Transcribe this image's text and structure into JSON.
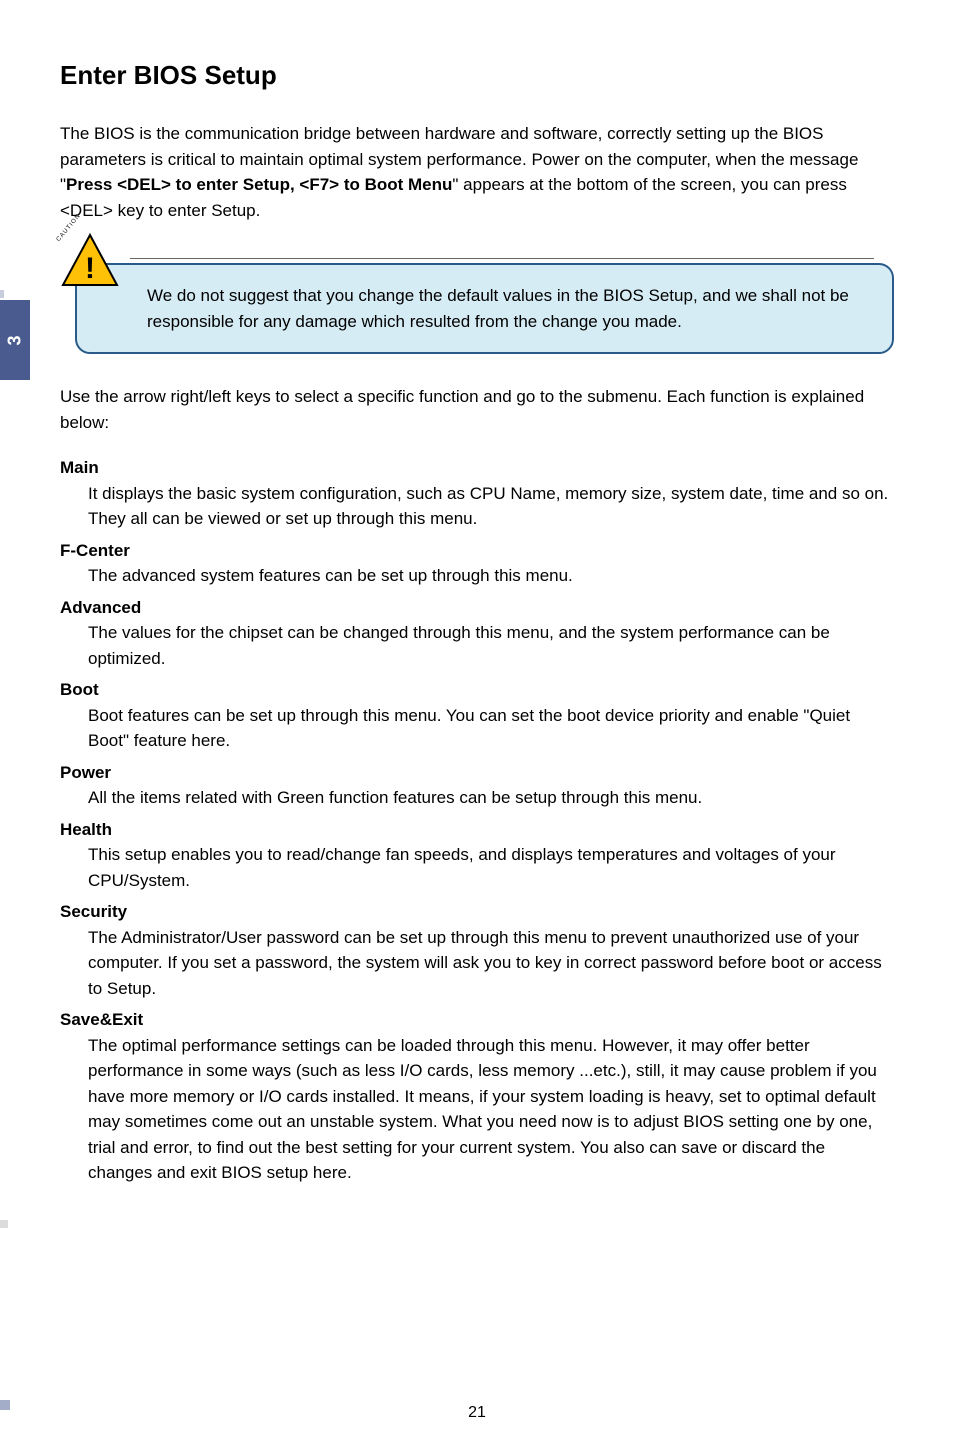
{
  "sideTab": "3",
  "title": "Enter BIOS Setup",
  "intro": {
    "part1": "The BIOS is the communication bridge between hardware and software, correctly setting up the BIOS parameters is critical to maintain optimal system performance. Power on the computer, when the message \"",
    "bold": "Press <DEL> to enter Setup, <F7> to Boot Menu",
    "part2": "\" appears at the bottom of the screen, you can press <DEL> key to enter Setup."
  },
  "caution": {
    "label": "CAUTION",
    "exclaim": "!",
    "text": "We do not suggest that you change the default values in the BIOS Setup, and we shall not be responsible for any damage which resulted from the change you made."
  },
  "postCaution": "Use the arrow right/left keys to select a specific function and go to the submenu. Each function is explained below:",
  "menus": [
    {
      "name": "Main",
      "desc": "It displays the basic system configuration, such as CPU Name, memory size, system date, time and so on. They all can be viewed or set up through this menu."
    },
    {
      "name": "F-Center",
      "desc": "The advanced system features can be set up through this menu."
    },
    {
      "name": "Advanced",
      "desc": "The values for the chipset can be changed through this menu, and the system performance can be optimized."
    },
    {
      "name": "Boot",
      "desc": "Boot features can be set up through this menu. You can set the boot device priority and enable \"Quiet Boot\" feature here."
    },
    {
      "name": "Power",
      "desc": "All the items related with Green function features can be setup through this menu."
    },
    {
      "name": "Health",
      "desc": "This setup enables you to read/change fan speeds, and displays temperatures and voltages of your CPU/System."
    },
    {
      "name": "Security",
      "desc": "The Administrator/User password can be set up through this menu to prevent unauthorized use of your computer. If you set a password, the system will ask you to key in correct password before boot or access to Setup."
    },
    {
      "name": "Save&Exit",
      "desc": "The optimal performance settings can be loaded through this menu. However, it may offer better performance in some ways (such as less I/O cards, less memory ...etc.),  still, it may cause problem if you have more memory or I/O cards installed. It means, if your system loading is heavy, set to optimal default may sometimes come out an unstable system. What you need now is to adjust BIOS setting one by one, trial and error, to find out the best setting for your current system. You also can save or discard the changes and exit BIOS setup here."
    }
  ],
  "pageNumber": "21"
}
